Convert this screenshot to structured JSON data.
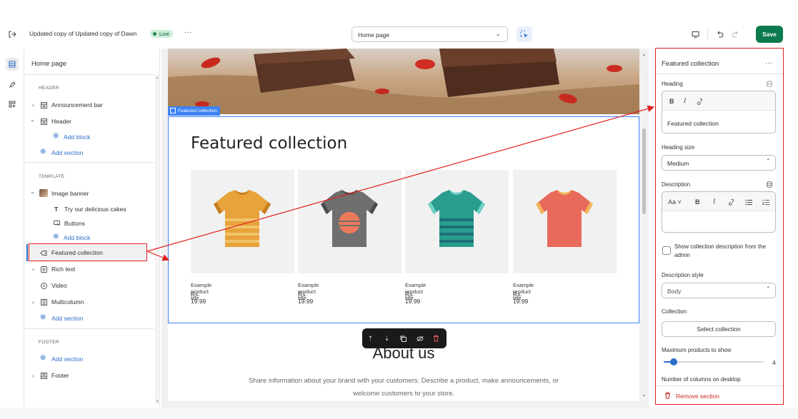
{
  "header": {
    "theme_name": "Updated copy of Updated copy of Dawn",
    "live_badge": "Live",
    "more_label": "···",
    "page_select": "Home page",
    "save_label": "Save"
  },
  "sidebar": {
    "title": "Home page",
    "header_label": "HEADER",
    "announcement_bar": "Announcement bar",
    "header_item": "Header",
    "add_block": "Add block",
    "add_section": "Add section",
    "template_label": "TEMPLATE",
    "image_banner": "Image banner",
    "banner_text": "Try our delicious cakes",
    "buttons": "Buttons",
    "add_block_2": "Add block",
    "featured_collection": "Featured collection",
    "rich_text": "Rich text",
    "video": "Video",
    "multicolumn": "Multicolumn",
    "add_section_2": "Add section",
    "footer_label": "FOOTER",
    "add_section_3": "Add section",
    "footer_item": "Footer"
  },
  "preview": {
    "section_tag": "Featured collection",
    "heading": "Featured collection",
    "products": [
      {
        "title": "Example product title",
        "price": "Rs. 19.99",
        "color": "#e8a33a",
        "stripe": "#f2c46b",
        "accent": "#c77e1f"
      },
      {
        "title": "Example product title",
        "price": "Rs. 19.99",
        "color": "#6f6f6f",
        "stripe": "#ef7a5a",
        "accent": "#4a4a4a"
      },
      {
        "title": "Example product title",
        "price": "Rs. 19.99",
        "color": "#2a9d8f",
        "stripe": "#1e6f78",
        "accent": "#6fd1c4"
      },
      {
        "title": "Example product title",
        "price": "Rs. 19.99",
        "color": "#e86a5b",
        "stripe": "#e86a5b",
        "accent": "#f2b65a"
      }
    ],
    "about_heading": "About us",
    "about_text_1": "Share information about your brand with your customers. Describe a product, make announcements, or",
    "about_text_2": "welcome customers to your store."
  },
  "panel": {
    "title": "Featured collection",
    "heading_label": "Heading",
    "heading_value": "Featured collection",
    "heading_size_label": "Heading size",
    "heading_size_value": "Medium",
    "description_label": "Description",
    "description_value": "",
    "font_dropdown": "Aa",
    "show_desc_label": "Show collection description from the admin",
    "desc_style_label": "Description style",
    "desc_style_value": "Body",
    "collection_label": "Collection",
    "select_collection": "Select collection",
    "max_products_label": "Maximum products to show",
    "max_products_value": "4",
    "max_products_fraction": 0.1,
    "columns_label": "Number of columns on desktop",
    "remove_section": "Remove section"
  },
  "colors": {
    "accent": "#2c6ecb",
    "save": "#0d7a4d",
    "highlight": "#e02020",
    "selection": "#3b82f6"
  }
}
